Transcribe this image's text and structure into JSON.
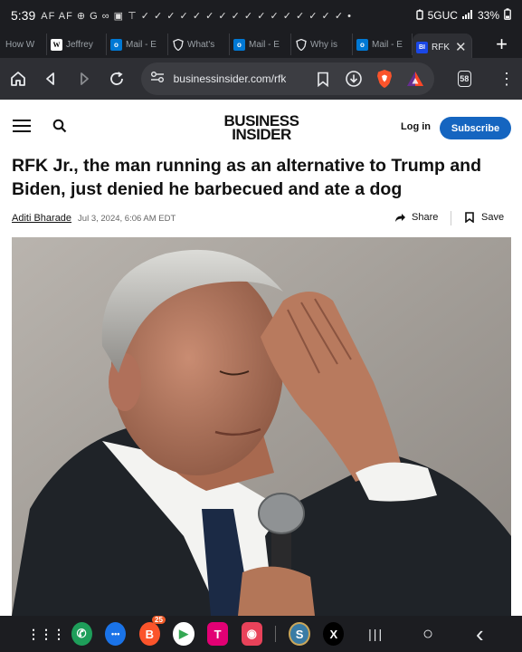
{
  "status_bar": {
    "time": "5:39",
    "notifications": "AF AF ⊕ G ∞ ▣ ⊤ ✓ ✓ ✓ ✓ ✓ ✓ ✓ ✓ ✓ ✓ ✓ ✓ ✓ ✓ ✓ ✓ •",
    "network": "5GUC",
    "battery": "33%"
  },
  "tabs": [
    {
      "label": "How W",
      "favicon": "",
      "color": "#3c3d42"
    },
    {
      "label": "Jeffrey",
      "favicon": "W",
      "color": "#ffffff"
    },
    {
      "label": "Mail - E",
      "favicon": "o",
      "color": "#0078d4"
    },
    {
      "label": "What's",
      "favicon": "shield",
      "color": "#e8eaed"
    },
    {
      "label": "Mail - E",
      "favicon": "o",
      "color": "#0078d4"
    },
    {
      "label": "Why is",
      "favicon": "shield",
      "color": "#e8eaed"
    },
    {
      "label": "Mail - E",
      "favicon": "o",
      "color": "#0078d4"
    },
    {
      "label": "RFK",
      "favicon": "BI",
      "color": "#1a47e6",
      "active": true
    }
  ],
  "toolbar": {
    "url": "businessinsider.com/rfk-",
    "tab_count": "58"
  },
  "site": {
    "logo_line1": "BUSINESS",
    "logo_line2": "INSIDER",
    "login_label": "Log in",
    "subscribe_label": "Subscribe"
  },
  "article": {
    "headline": "RFK Jr., the man running as an alternative to Trump and Biden, just denied he barbecued and ate a dog",
    "author": "Aditi Bharade",
    "date": "Jul 3, 2024, 6:06 AM EDT",
    "share_label": "Share",
    "save_label": "Save"
  },
  "nav_bar": {
    "apps": [
      {
        "name": "app-drawer",
        "glyph": "⋮⋮⋮",
        "color": "transparent"
      },
      {
        "name": "phone",
        "glyph": "✆",
        "color": "#1e9e5a"
      },
      {
        "name": "messages",
        "glyph": "•••",
        "color": "#1a73e8"
      },
      {
        "name": "brave",
        "glyph": "B",
        "color": "#fb542b",
        "badge": "25"
      },
      {
        "name": "play-store",
        "glyph": "▶",
        "color": "#ffffff"
      },
      {
        "name": "t-mobile",
        "glyph": "T",
        "color": "#e20074"
      },
      {
        "name": "camera",
        "glyph": "◉",
        "color": "#e8425a"
      },
      {
        "name": "simple",
        "glyph": "S",
        "color": "#3a7ca5"
      },
      {
        "name": "x",
        "glyph": "X",
        "color": "#000000"
      }
    ],
    "recents_glyph": "|||",
    "home_glyph": "○",
    "back_glyph": "‹"
  }
}
